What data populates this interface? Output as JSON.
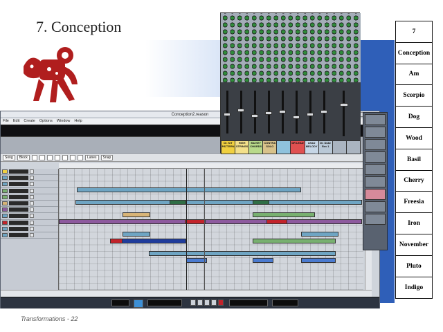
{
  "slide": {
    "title": "7. Conception",
    "footer": "Transformations - 22"
  },
  "side_table": [
    "7",
    "Conception",
    "Am",
    "Scorpio",
    "Dog",
    "Wood",
    "Basil",
    "Cherry",
    "Freesia",
    "Iron",
    "November",
    "Pluto",
    "Indigo"
  ],
  "reason_window": {
    "title": "Conception2.reason",
    "menu": [
      "File",
      "Edit",
      "Create",
      "Options",
      "Window",
      "Help"
    ],
    "toolbar": {
      "song": "Song",
      "block": "Block",
      "lanes": "Lanes",
      "snap": "Snap"
    }
  },
  "mixer": {
    "channel_labels": [
      [
        "Dr. KIT",
        "PATTERN"
      ],
      [
        "HIGH",
        "STRINGS"
      ],
      [
        "Ma KEY",
        "CHORDS"
      ],
      [
        "CONTRA",
        "SOLO"
      ],
      [
        "",
        ""
      ],
      [
        "",
        "DR LEAD"
      ],
      [
        "LEAD",
        "MELODY"
      ],
      [
        "Dr. Duke",
        "Rev 1"
      ],
      [
        "",
        ""
      ],
      [
        "",
        ""
      ]
    ]
  },
  "colors": {
    "clip_blue": "#6fa5c3",
    "clip_green": "#78b070",
    "clip_red": "#c2232b",
    "clip_purple": "#8d5a9e",
    "clip_tan": "#d8b477",
    "clip_dark_blue": "#1f3c9c",
    "accent_blue": "#2f5fb8"
  }
}
